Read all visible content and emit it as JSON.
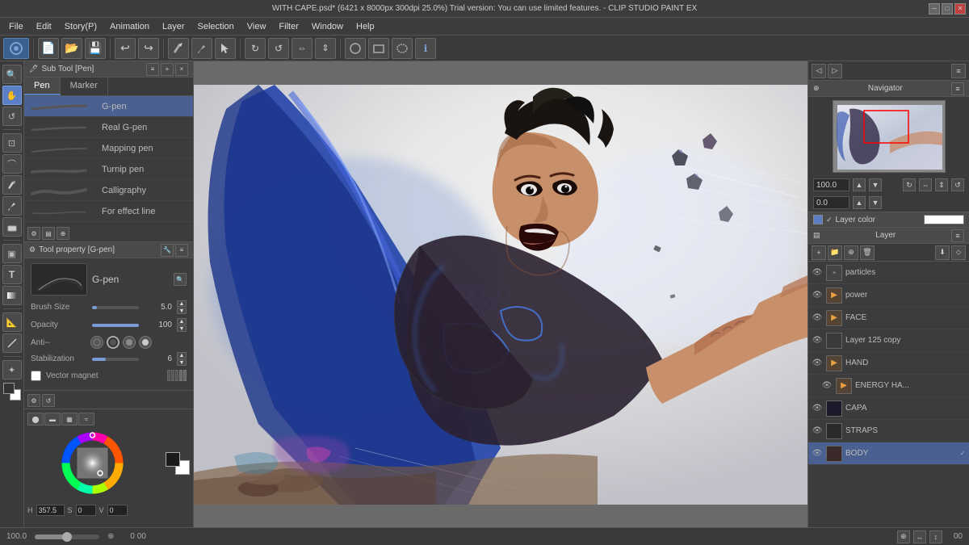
{
  "titlebar": {
    "text": "WITH CAPE.psd* (6421 x 8000px 300dpi 25.0%)  Trial version: You can use limited features. - CLIP STUDIO PAINT EX",
    "minimize": "─",
    "maximize": "□",
    "close": "✕"
  },
  "menubar": {
    "items": [
      "File",
      "Edit",
      "Story(P)",
      "Animation",
      "Layer",
      "Selection",
      "View",
      "Filter",
      "Window",
      "Help"
    ]
  },
  "toolbar": {
    "tools": [
      {
        "name": "clip-studio",
        "icon": "◉"
      },
      {
        "name": "new-file",
        "icon": "📄"
      },
      {
        "name": "open-file",
        "icon": "📂"
      },
      {
        "name": "save",
        "icon": "💾"
      },
      {
        "name": "undo",
        "icon": "↩"
      },
      {
        "name": "redo",
        "icon": "↪"
      },
      {
        "name": "zoom-in",
        "icon": "+🔍"
      },
      {
        "name": "zoom-out",
        "icon": "-🔍"
      },
      {
        "name": "rotate",
        "icon": "↻"
      },
      {
        "name": "flip",
        "icon": "⇔"
      },
      {
        "name": "brush-tool",
        "icon": "✏"
      },
      {
        "name": "eraser-tool",
        "icon": "⊡"
      },
      {
        "name": "fill-tool",
        "icon": "▣"
      },
      {
        "name": "select-tool",
        "icon": "⊠"
      },
      {
        "name": "move-tool",
        "icon": "✤"
      },
      {
        "name": "transform",
        "icon": "⊞"
      },
      {
        "name": "info",
        "icon": "ℹ"
      }
    ]
  },
  "left_tools": {
    "items": [
      {
        "name": "zoom-tool",
        "icon": "🔍"
      },
      {
        "name": "move-tool",
        "icon": "✋"
      },
      {
        "name": "rotate-view",
        "icon": "↺"
      },
      {
        "name": "select-rect",
        "icon": "⊡"
      },
      {
        "name": "select-lasso",
        "icon": "⌒"
      },
      {
        "name": "pen-tool",
        "icon": "✒"
      },
      {
        "name": "brush-tool",
        "icon": "🖌"
      },
      {
        "name": "eraser",
        "icon": "◻"
      },
      {
        "name": "fill",
        "icon": "▣"
      },
      {
        "name": "text-tool",
        "icon": "T"
      },
      {
        "name": "gradient",
        "icon": "▦"
      },
      {
        "name": "ruler",
        "icon": "📐"
      },
      {
        "name": "line-tool",
        "icon": "╱"
      },
      {
        "name": "color-picker",
        "icon": "✦"
      },
      {
        "name": "foreground-color",
        "icon": "■"
      },
      {
        "name": "background-color",
        "icon": "□"
      }
    ]
  },
  "sub_tool_panel": {
    "header": "Sub Tool [Pen]",
    "tabs": [
      "Pen",
      "Marker"
    ],
    "active_tab": "Pen",
    "brushes": [
      {
        "name": "G-pen",
        "stroke_width": 65
      },
      {
        "name": "Real G-pen",
        "stroke_width": 70
      },
      {
        "name": "Mapping pen",
        "stroke_width": 60
      },
      {
        "name": "Turnip pen",
        "stroke_width": 55
      },
      {
        "name": "Calligraphy",
        "stroke_width": 75
      },
      {
        "name": "For effect line",
        "stroke_width": 50
      }
    ],
    "active_brush": "G-pen"
  },
  "tool_property": {
    "header": "Tool property [G-pen]",
    "brush_name": "G-pen",
    "properties": {
      "brush_size": {
        "label": "Brush Size",
        "value": "5.0",
        "percent": 10
      },
      "opacity": {
        "label": "Opacity",
        "value": "100",
        "percent": 100
      },
      "anti_alias": {
        "label": "Anti--",
        "value": "2"
      },
      "stabilization": {
        "label": "Stabilization",
        "value": "6",
        "percent": 30
      },
      "vector_magnet": {
        "label": "Vector magnet",
        "value": ""
      }
    }
  },
  "color_panel": {
    "hue": 357.5,
    "saturation": 0,
    "value": 0,
    "foreground_hex": "#e03030",
    "background_hex": "#000000"
  },
  "navigator": {
    "header": "Navigator",
    "zoom": "100.0",
    "rotation": "0.0"
  },
  "layer_panel": {
    "header": "Layer",
    "layer_color_label": "Layer color",
    "layers": [
      {
        "name": "particles",
        "visible": true,
        "type": "normal",
        "is_folder": false
      },
      {
        "name": "power",
        "visible": true,
        "type": "folder",
        "is_folder": true
      },
      {
        "name": "FACE",
        "visible": true,
        "type": "folder",
        "is_folder": true
      },
      {
        "name": "Layer 125 copy",
        "visible": true,
        "type": "normal",
        "is_folder": false
      },
      {
        "name": "HAND",
        "visible": true,
        "type": "folder",
        "is_folder": true
      },
      {
        "name": "ENERGY HA...",
        "visible": true,
        "type": "folder",
        "is_folder": true,
        "indent": true
      },
      {
        "name": "CAPA",
        "visible": true,
        "type": "normal",
        "is_folder": false
      },
      {
        "name": "STRAPS",
        "visible": true,
        "type": "normal",
        "is_folder": false
      },
      {
        "name": "BODY",
        "visible": true,
        "type": "normal",
        "is_folder": false,
        "active": true
      }
    ]
  },
  "status_bar": {
    "zoom": "100.0",
    "coords_x": "0",
    "coords_y": "00",
    "nav_icon": "⊕"
  }
}
